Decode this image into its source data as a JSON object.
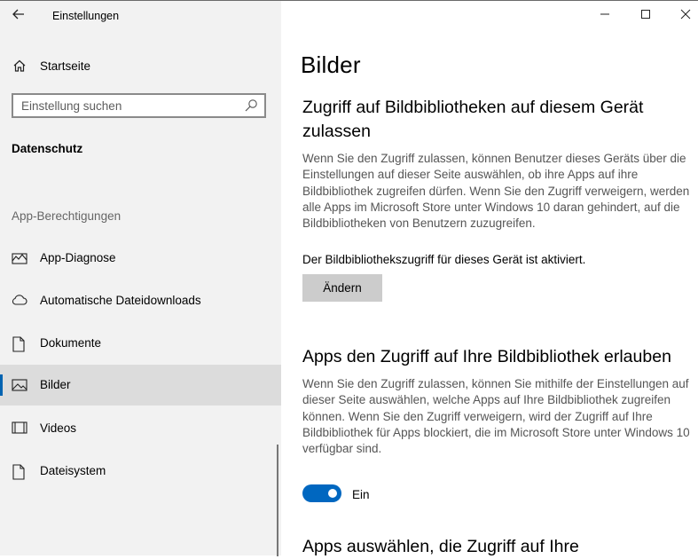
{
  "window": {
    "title": "Einstellungen",
    "controls": [
      "minimize",
      "maximize",
      "close"
    ]
  },
  "sidebar": {
    "home_label": "Startseite",
    "search": {
      "placeholder": "Einstellung suchen",
      "value": ""
    },
    "section_title": "Datenschutz",
    "group_title": "App-Berechtigungen",
    "items": [
      {
        "label": "App-Diagnose",
        "icon": "app-diagnostics-icon",
        "selected": false
      },
      {
        "label": "Automatische Dateidownloads",
        "icon": "cloud-icon",
        "selected": false
      },
      {
        "label": "Dokumente",
        "icon": "document-icon",
        "selected": false
      },
      {
        "label": "Bilder",
        "icon": "image-icon",
        "selected": true
      },
      {
        "label": "Videos",
        "icon": "video-icon",
        "selected": false
      },
      {
        "label": "Dateisystem",
        "icon": "file-icon",
        "selected": false
      }
    ]
  },
  "main": {
    "page_title": "Bilder",
    "section1": {
      "heading": "Zugriff auf Bildbibliotheken auf diesem Gerät zulassen",
      "description": "Wenn Sie den Zugriff zulassen, können Benutzer dieses Geräts über die Einstellungen auf dieser Seite auswählen, ob ihre Apps auf ihre Bildbibliothek zugreifen dürfen. Wenn Sie den Zugriff verweigern, werden alle Apps im Microsoft Store unter Windows 10 daran gehindert, auf die Bildbibliotheken von Benutzern zuzugreifen.",
      "status": "Der Bildbibliothekszugriff für dieses Gerät ist aktiviert.",
      "button_label": "Ändern"
    },
    "section2": {
      "heading": "Apps den Zugriff auf Ihre Bildbibliothek erlauben",
      "description": "Wenn Sie den Zugriff zulassen, können Sie mithilfe der Einstellungen auf dieser Seite auswählen, welche Apps auf Ihre Bildbibliothek zugreifen können. Wenn Sie den Zugriff verweigern, wird der Zugriff auf Ihre Bildbibliothek für Apps blockiert, die im Microsoft Store unter Windows 10 verfügbar sind.",
      "toggle_state": true,
      "toggle_label": "Ein"
    },
    "section3": {
      "heading": "Apps auswählen, die Zugriff auf Ihre"
    }
  },
  "colors": {
    "accent": "#0067c0",
    "sidebar_bg": "#f2f2f2",
    "selected_bg": "#dcdcdc",
    "button_bg": "#cccccc"
  }
}
